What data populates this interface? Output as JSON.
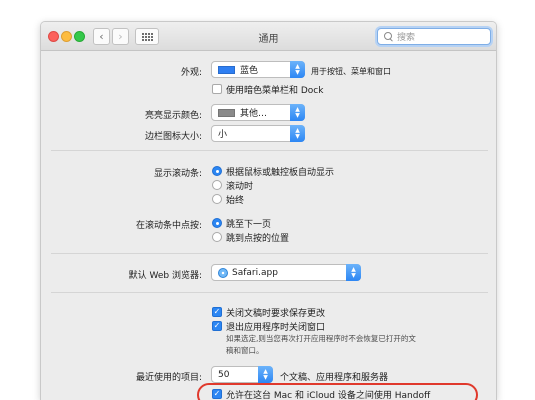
{
  "window": {
    "title": "通用",
    "search_placeholder": "搜索",
    "back_glyph": "‹",
    "forward_glyph": "›"
  },
  "appearance": {
    "label": "外观:",
    "value": "蓝色",
    "swatch_color": "#2f7ff2",
    "note": "用于按钮、菜单和窗口"
  },
  "dark_menu": {
    "label": "使用暗色菜单栏和 Dock",
    "checked": false
  },
  "highlight_color": {
    "label": "亮亮显示颜色:",
    "value": "其他…",
    "swatch_color": "#8a8a8a"
  },
  "sidebar_icon_size": {
    "label": "边栏图标大小:",
    "value": "小"
  },
  "scrollbars": {
    "label": "显示滚动条:",
    "options": [
      "根据鼠标或触控板自动显示",
      "滚动时",
      "始终"
    ],
    "selected": 0
  },
  "click_scroll": {
    "label": "在滚动条中点按:",
    "options": [
      "跳至下一页",
      "跳到点按的位置"
    ],
    "selected": 0
  },
  "default_browser": {
    "label": "默认 Web 浏览器:",
    "value": "Safari.app"
  },
  "documents": {
    "ask_keep": "关闭文稿时要求保存更改",
    "close_windows": "退出应用程序时关闭窗口",
    "description_line1": "如果选定,则当您再次打开应用程序时不会恢复已打开的文",
    "description_line2": "稿和窗口。"
  },
  "recent_items": {
    "label": "最近使用的项目:",
    "value": "50",
    "suffix": "个文稿、应用程序和服务器"
  },
  "handoff": {
    "label": "允许在这台 Mac 和 iCloud 设备之间使用 Handoff",
    "checked": true,
    "highlight_color": "#e0392c"
  },
  "accent_color": "#2b86f3"
}
